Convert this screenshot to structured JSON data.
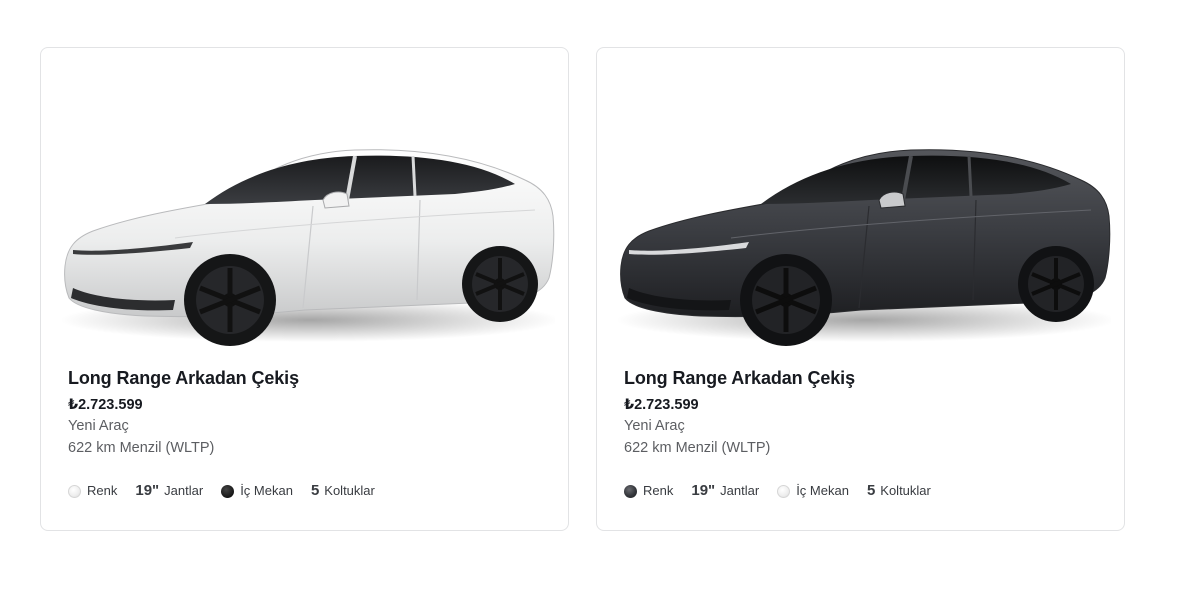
{
  "cards": [
    {
      "model_name": "Long Range Arkadan Çekiş",
      "price": "₺2.723.599",
      "condition": "Yeni Araç",
      "range": "622 km Menzil (WLTP)",
      "paint": "white",
      "specs": {
        "color_label": "Renk",
        "color_swatch": "#f0f0f0",
        "wheels_value": "19\"",
        "wheels_label": "Jantlar",
        "interior_label": "İç Mekan",
        "interior_swatch": "#111111",
        "seats_value": "5",
        "seats_label": "Koltuklar"
      }
    },
    {
      "model_name": "Long Range Arkadan Çekiş",
      "price": "₺2.723.599",
      "condition": "Yeni Araç",
      "range": "622 km Menzil (WLTP)",
      "paint": "dark-grey",
      "specs": {
        "color_label": "Renk",
        "color_swatch": "#3a3c40",
        "wheels_value": "19\"",
        "wheels_label": "Jantlar",
        "interior_label": "İç Mekan",
        "interior_swatch": "#f0f0f0",
        "seats_value": "5",
        "seats_label": "Koltuklar"
      }
    }
  ]
}
